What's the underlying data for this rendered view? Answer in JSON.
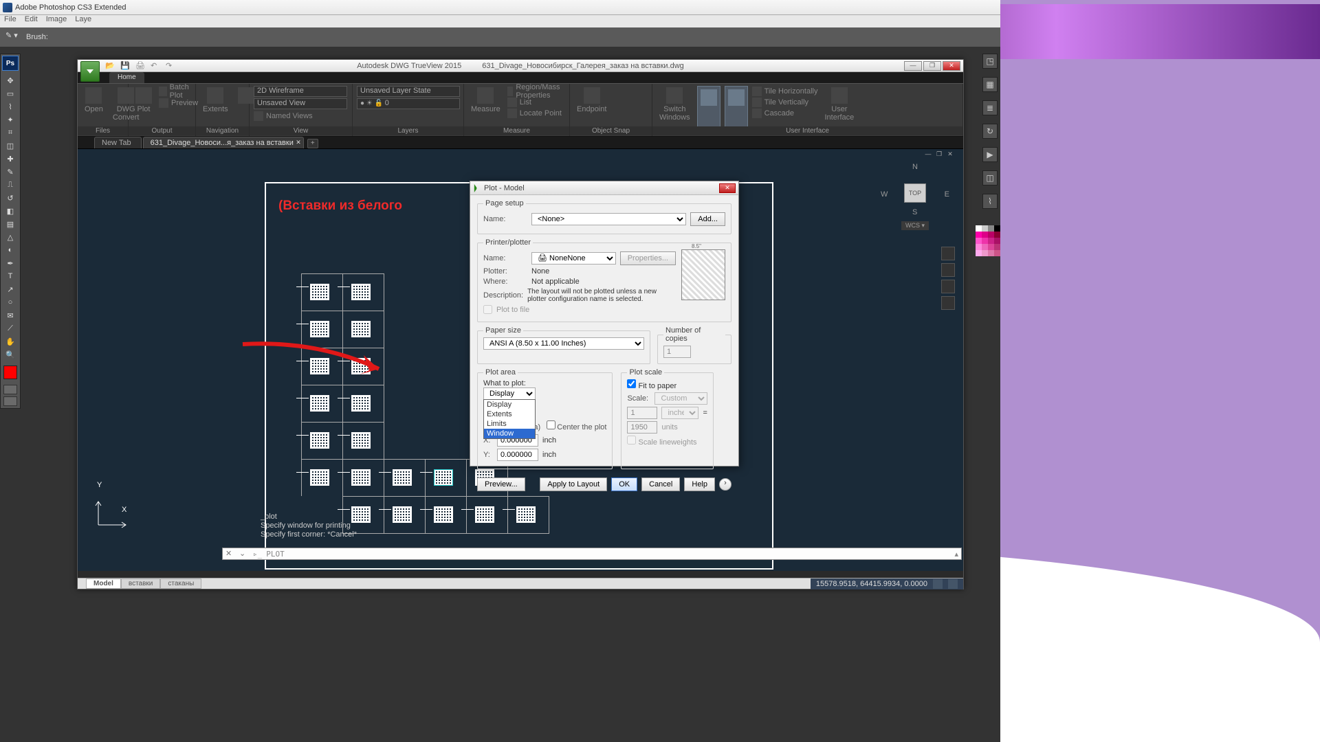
{
  "ps": {
    "title": "Adobe Photoshop CS3 Extended",
    "menu": [
      "File",
      "Edit",
      "Image",
      "Laye"
    ],
    "opt_brush_label": "Brush:"
  },
  "dwg": {
    "qat_tips": [
      "open",
      "save",
      "plot",
      "undo",
      "redo"
    ],
    "app_name": "Autodesk DWG TrueView 2015",
    "doc_name": "631_Divage_Новосибирск_Галерея_заказ на вставки.dwg",
    "ribbon_tab": "Home",
    "panels": {
      "files": {
        "label": "Files",
        "open": "Open",
        "convert": "DWG\nConvert"
      },
      "output": {
        "label": "Output",
        "plot": "Plot",
        "batch": "Batch Plot",
        "preview": "Preview"
      },
      "nav": {
        "label": "Navigation",
        "extents": "Extents"
      },
      "view": {
        "label": "View",
        "vs": "2D Wireframe",
        "uv": "Unsaved View",
        "nv": "Named Views"
      },
      "layers": {
        "label": "Layers",
        "ls": "Unsaved Layer State",
        "lay0": "0"
      },
      "measure": {
        "label": "Measure",
        "m": "Measure",
        "rmp": "Region/Mass Properties",
        "list": "List",
        "lp": "Locate Point"
      },
      "osnap": {
        "label": "Object Snap",
        "ep": "Endpoint"
      },
      "ui": {
        "label": "User Interface",
        "sw": "Switch\nWindows",
        "th": "Tile Horizontally",
        "tv": "Tile Vertically",
        "cas": "Cascade",
        "user": "User\nInterface"
      }
    },
    "doc_tabs": {
      "new": "New Tab",
      "cur": "631_Divage_Новоси...я_заказ на вставки"
    },
    "annotation": "(Вставки из белого",
    "viewcube": {
      "top": "TOP",
      "wcs": "WCS ▾",
      "n": "N",
      "s": "S",
      "e": "E",
      "w": "W"
    },
    "cmd_log": [
      "_plot",
      "Specify window for printing",
      "Specify first corner: *Cancel*"
    ],
    "cmd_prompt": "PLOT",
    "layout_tabs": [
      "Model",
      "вставки",
      "стаканы"
    ],
    "coords": "15578.9518, 64415.9934, 0.0000"
  },
  "plot": {
    "title": "Plot - Model",
    "page_setup": {
      "legend": "Page setup",
      "name_l": "Name:",
      "name_v": "<None>",
      "add": "Add..."
    },
    "printer": {
      "legend": "Printer/plotter",
      "name_l": "Name:",
      "name_v": "None",
      "props": "Properties...",
      "plotter_l": "Plotter:",
      "plotter_v": "None",
      "where_l": "Where:",
      "where_v": "Not applicable",
      "desc_l": "Description:",
      "desc_v": "The layout will not be plotted unless a new plotter configuration name is selected.",
      "ptf": "Plot to file"
    },
    "paper": {
      "legend": "Paper size",
      "v": "ANSI A (8.50 x 11.00 Inches)",
      "copies_l": "Number of copies",
      "copies_v": "1"
    },
    "area": {
      "legend": "Plot area",
      "wtp_l": "What to plot:",
      "wtp_v": "Display",
      "opts": [
        "Display",
        "Extents",
        "Limits",
        "Window"
      ],
      "hl": "Window",
      "offset_hint": "to printable area)",
      "center": "Center the plot",
      "x_l": "X:",
      "x_v": "0.000000",
      "y_l": "Y:",
      "y_v": "0.000000",
      "unit": "inch"
    },
    "scale": {
      "legend": "Plot scale",
      "fit": "Fit to paper",
      "scale_l": "Scale:",
      "scale_v": "Custom",
      "n1": "1",
      "u1": "inches",
      "n2": "1950",
      "u2": "units",
      "slw": "Scale lineweights"
    },
    "buttons": {
      "preview": "Preview...",
      "apply": "Apply to Layout",
      "ok": "OK",
      "cancel": "Cancel",
      "help": "Help"
    }
  }
}
